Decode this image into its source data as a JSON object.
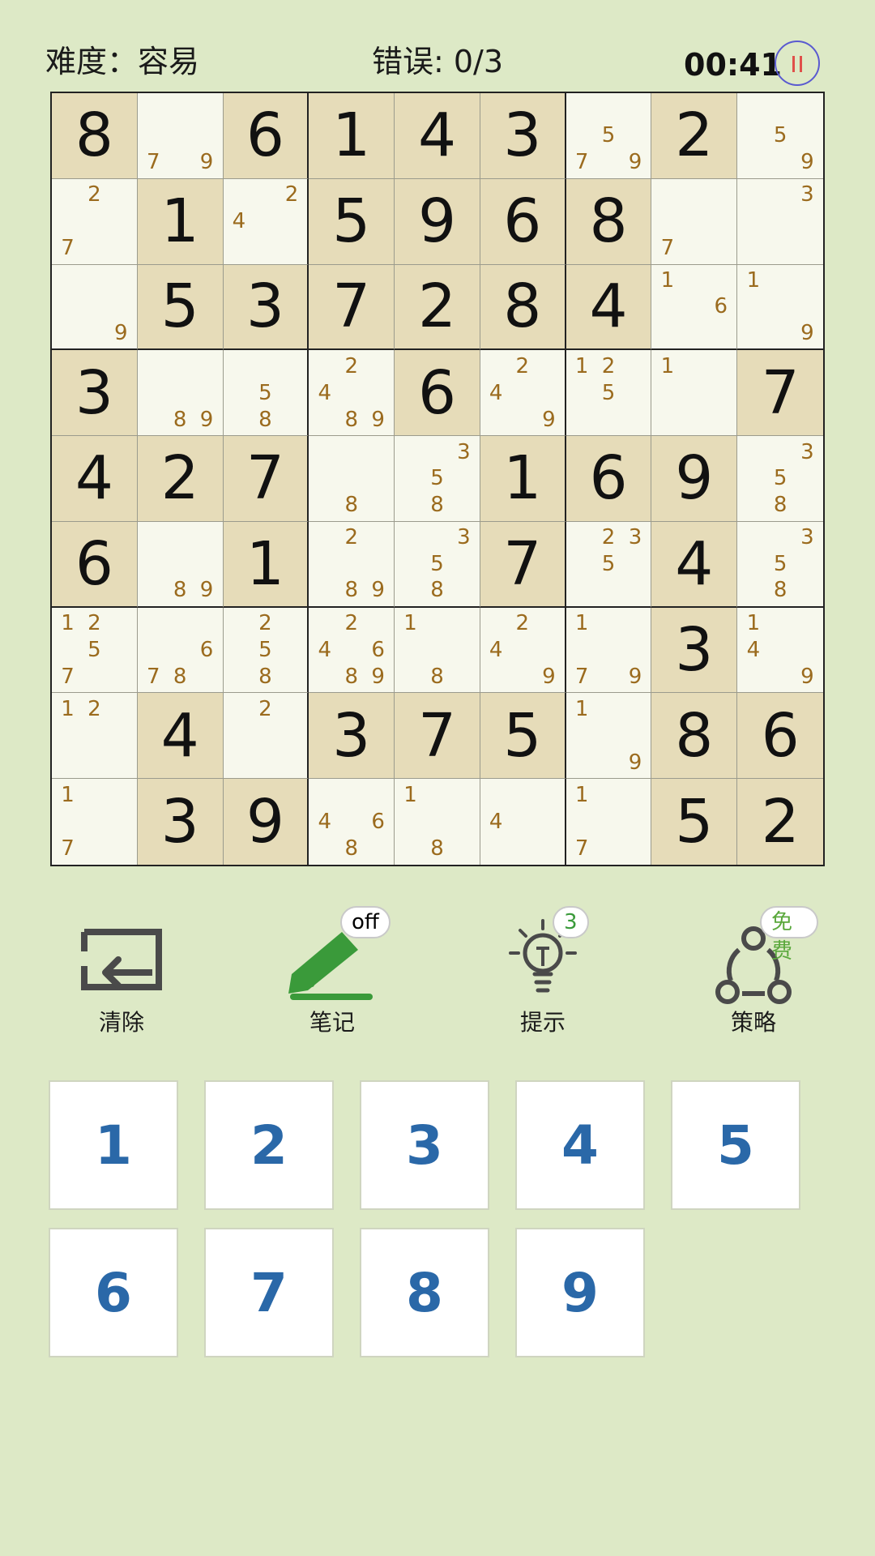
{
  "header": {
    "difficulty": "难度：容易",
    "errors": "错误: 0/3",
    "timer": "00:41"
  },
  "board": [
    [
      {
        "v": "8",
        "g": true
      },
      {
        "n": [
          "7",
          "9"
        ],
        "p": [
          6,
          8
        ]
      },
      {
        "v": "6",
        "g": true
      },
      {
        "v": "1",
        "g": true
      },
      {
        "v": "4",
        "g": true
      },
      {
        "v": "3",
        "g": true
      },
      {
        "n": [
          "5",
          "7",
          "9"
        ],
        "p": [
          4,
          6,
          8
        ]
      },
      {
        "v": "2",
        "g": true
      },
      {
        "n": [
          "5",
          "9"
        ],
        "p": [
          4,
          8
        ]
      }
    ],
    [
      {
        "n": [
          "2",
          "7"
        ],
        "p": [
          1,
          6
        ]
      },
      {
        "v": "1",
        "g": true
      },
      {
        "n": [
          "2",
          "4"
        ],
        "p": [
          2,
          3
        ]
      },
      {
        "v": "5",
        "g": true
      },
      {
        "v": "9",
        "g": true
      },
      {
        "v": "6",
        "g": true
      },
      {
        "v": "8",
        "g": true
      },
      {
        "n": [
          "7"
        ],
        "p": [
          6
        ]
      },
      {
        "n": [
          "3"
        ],
        "p": [
          2
        ]
      }
    ],
    [
      {
        "n": [
          "9"
        ],
        "p": [
          8
        ]
      },
      {
        "v": "5",
        "g": true
      },
      {
        "v": "3",
        "g": true
      },
      {
        "v": "7",
        "g": true
      },
      {
        "v": "2",
        "g": true
      },
      {
        "v": "8",
        "g": true
      },
      {
        "v": "4",
        "g": true
      },
      {
        "n": [
          "1",
          "6"
        ],
        "p": [
          0,
          5
        ]
      },
      {
        "n": [
          "1",
          "9"
        ],
        "p": [
          0,
          8
        ]
      }
    ],
    [
      {
        "v": "3",
        "g": true
      },
      {
        "n": [
          "8",
          "9"
        ],
        "p": [
          7,
          8
        ]
      },
      {
        "n": [
          "5",
          "8"
        ],
        "p": [
          4,
          7
        ]
      },
      {
        "n": [
          "2",
          "4",
          "8",
          "9"
        ],
        "p": [
          1,
          3,
          7,
          8
        ]
      },
      {
        "v": "6",
        "g": true
      },
      {
        "n": [
          "2",
          "4",
          "9"
        ],
        "p": [
          1,
          3,
          8
        ]
      },
      {
        "n": [
          "1",
          "2",
          "5"
        ],
        "p": [
          0,
          1,
          4
        ]
      },
      {
        "n": [
          "1"
        ],
        "p": [
          0
        ]
      },
      {
        "v": "7",
        "g": true
      }
    ],
    [
      {
        "v": "4",
        "g": true
      },
      {
        "v": "2",
        "g": true
      },
      {
        "v": "7",
        "g": true
      },
      {
        "n": [
          "8"
        ],
        "p": [
          7
        ]
      },
      {
        "n": [
          "3",
          "5",
          "8"
        ],
        "p": [
          2,
          4,
          7
        ]
      },
      {
        "v": "1",
        "g": true
      },
      {
        "v": "6",
        "g": true
      },
      {
        "v": "9",
        "g": true
      },
      {
        "n": [
          "3",
          "5",
          "8"
        ],
        "p": [
          2,
          4,
          7
        ]
      }
    ],
    [
      {
        "v": "6",
        "g": true
      },
      {
        "n": [
          "8",
          "9"
        ],
        "p": [
          7,
          8
        ]
      },
      {
        "v": "1",
        "g": true
      },
      {
        "n": [
          "2",
          "8",
          "9"
        ],
        "p": [
          1,
          7,
          8
        ]
      },
      {
        "n": [
          "3",
          "5",
          "8"
        ],
        "p": [
          2,
          4,
          7
        ]
      },
      {
        "v": "7",
        "g": true
      },
      {
        "n": [
          "2",
          "3",
          "5"
        ],
        "p": [
          1,
          2,
          4
        ]
      },
      {
        "v": "4",
        "g": true
      },
      {
        "n": [
          "3",
          "5",
          "8"
        ],
        "p": [
          2,
          4,
          7
        ]
      }
    ],
    [
      {
        "n": [
          "1",
          "2",
          "5",
          "7"
        ],
        "p": [
          0,
          1,
          4,
          6
        ]
      },
      {
        "n": [
          "6",
          "7",
          "8"
        ],
        "p": [
          5,
          6,
          7
        ]
      },
      {
        "n": [
          "2",
          "5",
          "8"
        ],
        "p": [
          1,
          4,
          7
        ]
      },
      {
        "n": [
          "2",
          "4",
          "6",
          "8",
          "9"
        ],
        "p": [
          1,
          3,
          5,
          7,
          8
        ]
      },
      {
        "n": [
          "1",
          "8"
        ],
        "p": [
          0,
          7
        ]
      },
      {
        "n": [
          "2",
          "4",
          "9"
        ],
        "p": [
          1,
          3,
          8
        ]
      },
      {
        "n": [
          "1",
          "7",
          "9"
        ],
        "p": [
          0,
          6,
          8
        ]
      },
      {
        "v": "3",
        "g": true
      },
      {
        "n": [
          "1",
          "4",
          "9"
        ],
        "p": [
          0,
          3,
          8
        ]
      }
    ],
    [
      {
        "n": [
          "1",
          "2"
        ],
        "p": [
          0,
          1
        ]
      },
      {
        "v": "4",
        "g": true
      },
      {
        "n": [
          "2"
        ],
        "p": [
          1
        ]
      },
      {
        "v": "3",
        "g": true
      },
      {
        "v": "7",
        "g": true
      },
      {
        "v": "5",
        "g": true
      },
      {
        "n": [
          "1",
          "9"
        ],
        "p": [
          0,
          8
        ]
      },
      {
        "v": "8",
        "g": true
      },
      {
        "v": "6",
        "g": true
      }
    ],
    [
      {
        "n": [
          "1",
          "7"
        ],
        "p": [
          0,
          6
        ]
      },
      {
        "v": "3",
        "g": true
      },
      {
        "v": "9",
        "g": true
      },
      {
        "n": [
          "4",
          "6",
          "8"
        ],
        "p": [
          3,
          5,
          7
        ]
      },
      {
        "n": [
          "1",
          "8"
        ],
        "p": [
          0,
          7
        ]
      },
      {
        "n": [
          "4"
        ],
        "p": [
          3
        ]
      },
      {
        "n": [
          "1",
          "7"
        ],
        "p": [
          0,
          6
        ]
      },
      {
        "v": "5",
        "g": true
      },
      {
        "v": "2",
        "g": true
      }
    ]
  ],
  "tools": {
    "clear": {
      "label": "清除",
      "icon": "clear-icon"
    },
    "notes": {
      "label": "笔记",
      "badge": "off",
      "icon": "pencil-icon"
    },
    "hint": {
      "label": "提示",
      "badge": "3",
      "icon": "lightbulb-icon"
    },
    "strategy": {
      "label": "策略",
      "badge": "免费",
      "icon": "strategy-icon"
    }
  },
  "numpad": [
    "1",
    "2",
    "3",
    "4",
    "5",
    "6",
    "7",
    "8",
    "9"
  ],
  "colors": {
    "background": "#dde9c6",
    "given_cell": "#e6dcb9",
    "empty_cell": "#f7f8ed",
    "note": "#9b6b1e",
    "numpad_digit": "#2a68a8",
    "notes_icon": "#3a9a3a",
    "strategy_badge": "#5aa83c"
  }
}
